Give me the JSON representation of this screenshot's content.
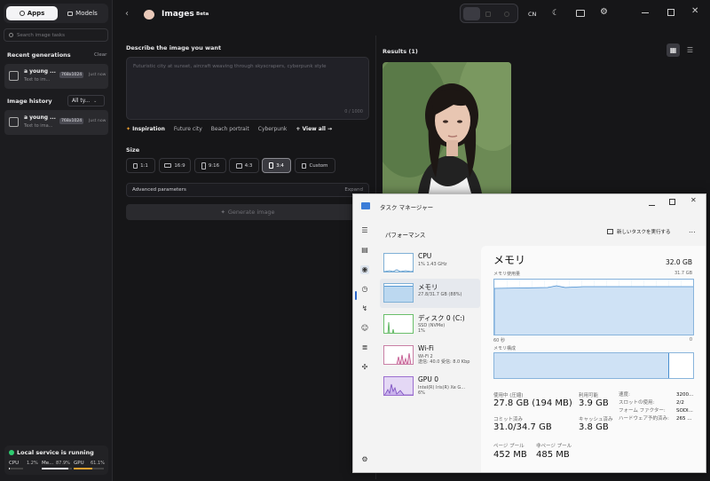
{
  "sidebar": {
    "tab_apps": "Apps",
    "tab_models": "Models",
    "search_placeholder": "Search image tasks",
    "recent_title": "Recent generations",
    "recent_clear": "Clear",
    "recent_item": {
      "title": "a young ...",
      "sub": "Text to im...",
      "badge": "768x1024",
      "time": "Just now"
    },
    "history_title": "Image history",
    "history_filter": "All ty...",
    "history_item": {
      "title": "a young ...",
      "sub": "Text to ima...",
      "badge": "768x1024",
      "time": "Just now"
    },
    "status": {
      "text": "Local service is running",
      "cpu_label": "CPU",
      "cpu_val": "1.2%",
      "mem_label": "Me...",
      "mem_val": "87.9%",
      "gpu_label": "GPU",
      "gpu_val": "61.1%",
      "cpu_pct": 1.2,
      "mem_pct": 87.9,
      "gpu_pct": 61.1
    }
  },
  "topbar": {
    "title": "Images",
    "badge": "Beta",
    "lang": "CN"
  },
  "form": {
    "describe_label": "Describe the image you want",
    "prompt_placeholder": "Futuristic city at sunset, aircraft weaving through skyscrapers, cyberpunk style",
    "counter": "0 / 1000",
    "inspiration_label": "Inspiration",
    "inspirations": [
      "Future city",
      "Beach portrait",
      "Cyberpunk"
    ],
    "view_all": "+ View all →",
    "size_label": "Size",
    "sizes": [
      "1:1",
      "16:9",
      "9:16",
      "4:3",
      "3:4",
      "Custom"
    ],
    "active_size": "3:4",
    "advanced_label": "Advanced parameters",
    "advanced_action": "Expand",
    "generate_label": "Generate image"
  },
  "results": {
    "title": "Results (1)"
  },
  "taskmanager": {
    "title": "タスク マネージャー",
    "section": "パフォーマンス",
    "new_task": "新しいタスクを実行する",
    "more": "...",
    "list": [
      {
        "name": "CPU",
        "sub": "1% 1.43 GHz"
      },
      {
        "name": "メモリ",
        "sub": "27.8/31.7 GB (88%)"
      },
      {
        "name": "ディスク 0 (C:)",
        "sub": "SSD (NVMe)\n1%"
      },
      {
        "name": "Wi-Fi",
        "sub": "Wi-Fi 2\n送信: 40.0 受信: 8.0 Kbp"
      },
      {
        "name": "GPU 0",
        "sub": "Intel(R) Iris(R) Xe G...\n6%"
      }
    ],
    "detail": {
      "heading": "メモリ",
      "total": "32.0 GB",
      "usage_label": "メモリ使用量",
      "usage_max": "31.7 GB",
      "axis_left": "60 秒",
      "axis_right": "0",
      "composition_label": "メモリ構成",
      "used_fraction": 0.88,
      "stats": [
        {
          "label": "使用中 (圧縮)",
          "value": "27.8 GB (194 MB)"
        },
        {
          "label": "利用可能",
          "value": "3.9 GB"
        },
        {
          "label": "コミット済み",
          "value": "31.0/34.7 GB"
        },
        {
          "label": "キャッシュ済み",
          "value": "3.8 GB"
        },
        {
          "label": "ページ プール",
          "value": "452 MB"
        },
        {
          "label": "非ページ プール",
          "value": "485 MB"
        }
      ],
      "props": [
        {
          "label": "速度:",
          "value": "3200..."
        },
        {
          "label": "スロットの使用:",
          "value": "2/2"
        },
        {
          "label": "フォーム ファクター:",
          "value": "SODI..."
        },
        {
          "label": "ハードウェア予約済み:",
          "value": "265 ..."
        }
      ]
    }
  }
}
